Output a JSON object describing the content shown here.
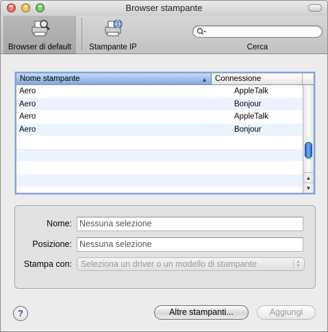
{
  "window": {
    "title": "Browser stampante"
  },
  "toolbar": {
    "default_browser_label": "Browser di default",
    "ip_printer_label": "Stampante IP",
    "search_label": "Cerca",
    "search_value": ""
  },
  "printer_list": {
    "columns": [
      "Nome stampante",
      "Connessione"
    ],
    "sorted_column": "Nome stampante",
    "rows": [
      {
        "name": "Aero",
        "connection": "AppleTalk"
      },
      {
        "name": "Aero",
        "connection": "Bonjour"
      },
      {
        "name": "Aero",
        "connection": "AppleTalk"
      },
      {
        "name": "Aero",
        "connection": "Bonjour"
      },
      {
        "name": "",
        "connection": ""
      },
      {
        "name": "",
        "connection": ""
      },
      {
        "name": "",
        "connection": ""
      },
      {
        "name": "",
        "connection": ""
      }
    ]
  },
  "details": {
    "name_label": "Nome:",
    "name_value": "Nessuna selezione",
    "location_label": "Posizione:",
    "location_value": "Nessuna selezione",
    "print_with_label": "Stampa con:",
    "print_with_value": "Seleziona un driver o un modello di stampante"
  },
  "footer": {
    "help_label": "?",
    "more_printers_label": "Altre stampanti...",
    "add_label": "Aggiungi"
  },
  "colors": {
    "accent": "#7fa9e0",
    "alt_row": "#edf3fe"
  }
}
